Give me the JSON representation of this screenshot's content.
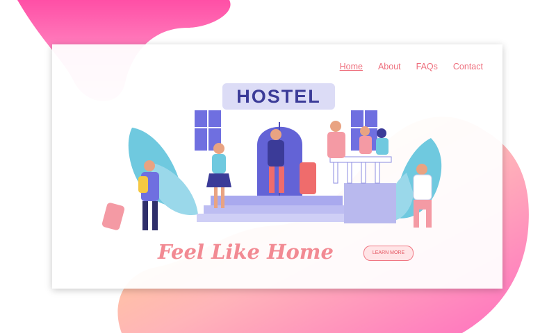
{
  "nav": {
    "home": "Home",
    "about": "About",
    "faqs": "FAQs",
    "contact": "Contact"
  },
  "hero": {
    "sign_text": "HOSTEL",
    "headline": "Feel Like Home",
    "cta_label": "LEARN MORE"
  },
  "colors": {
    "accent": "#ee6f7d",
    "purple": "#6f6fe0",
    "leaf": "#6fc9df"
  }
}
